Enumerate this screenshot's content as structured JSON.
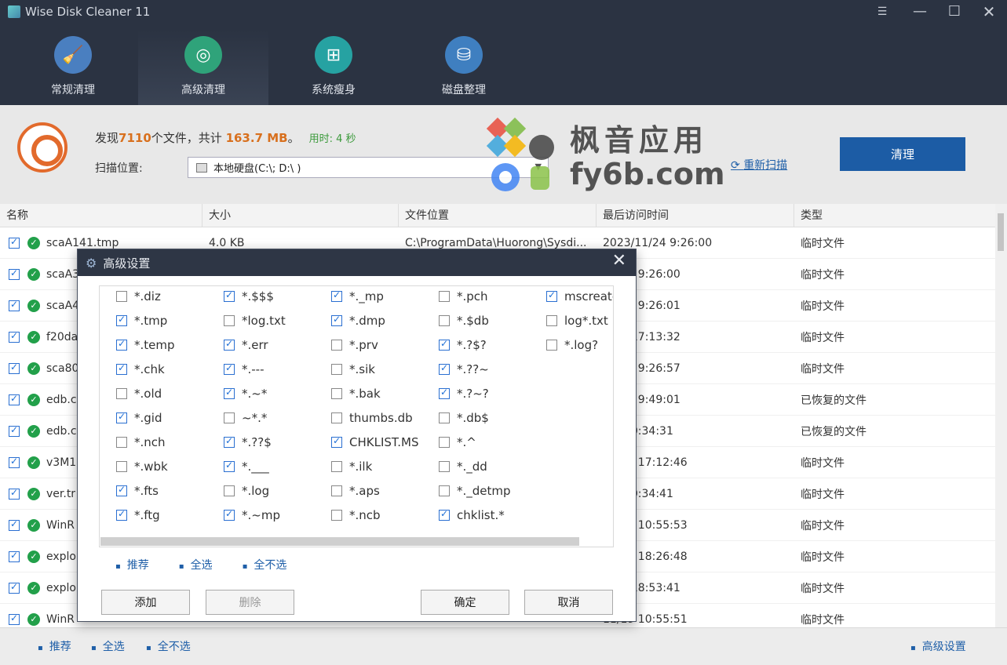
{
  "window": {
    "title": "Wise Disk Cleaner 11"
  },
  "tabs": [
    {
      "label": "常规清理",
      "color": "#4a7fc0",
      "icon": "broom-icon"
    },
    {
      "label": "高级清理",
      "color": "#2fa37a",
      "icon": "advanced-clean-icon"
    },
    {
      "label": "系统瘦身",
      "color": "#26a2a2",
      "icon": "windows-icon"
    },
    {
      "label": "磁盘整理",
      "color": "#3f7fc0",
      "icon": "disk-defrag-icon"
    }
  ],
  "summary": {
    "prefix": "发现",
    "count": "7110",
    "mid": "个文件，共计",
    "size": "163.7 MB",
    "suffix": "。",
    "time": "用时: 4 秒",
    "scan_label": "扫描位置:",
    "scan_value": "本地硬盘(C:\\; D:\\ )",
    "rescan": "重新扫描",
    "clean": "清理"
  },
  "watermark": {
    "line1": "枫音应用",
    "line2": "fy6b.com"
  },
  "table": {
    "columns": [
      "名称",
      "大小",
      "文件位置",
      "最后访问时间",
      "类型"
    ],
    "rows": [
      {
        "name": "scaA141.tmp",
        "size": "4.0 KB",
        "path": "C:\\ProgramData\\Huorong\\Sysdi...",
        "time": "2023/11/24 9:26:00",
        "type": "临时文件"
      },
      {
        "name": "scaA3",
        "size": "",
        "path": "",
        "time": "11/24 9:26:00",
        "type": "临时文件"
      },
      {
        "name": "scaA4",
        "size": "",
        "path": "",
        "time": "11/24 9:26:01",
        "type": "临时文件"
      },
      {
        "name": "f20da",
        "size": "",
        "path": "",
        "time": "3/14 17:13:32",
        "type": "临时文件"
      },
      {
        "name": "sca80",
        "size": "",
        "path": "",
        "time": "11/24 9:26:57",
        "type": "临时文件"
      },
      {
        "name": "edb.c",
        "size": "",
        "path": "",
        "time": "11/24 9:49:01",
        "type": "已恢复的文件"
      },
      {
        "name": "edb.c",
        "size": "",
        "path": "",
        "time": "3/3 20:34:31",
        "type": "已恢复的文件"
      },
      {
        "name": "v3M1",
        "size": "",
        "path": "",
        "time": "10/27 17:12:46",
        "type": "临时文件"
      },
      {
        "name": "ver.tr",
        "size": "",
        "path": "",
        "time": "4/22 0:34:41",
        "type": "临时文件"
      },
      {
        "name": "WinR",
        "size": "",
        "path": "",
        "time": "11/19 10:55:53",
        "type": "临时文件"
      },
      {
        "name": "explo",
        "size": "",
        "path": "",
        "time": "11/11 18:26:48",
        "type": "临时文件"
      },
      {
        "name": "explo",
        "size": "",
        "path": "",
        "time": "11/9 18:53:41",
        "type": "临时文件"
      },
      {
        "name": "WinR",
        "size": "",
        "path": "",
        "time": "11/19 10:55:51",
        "type": "临时文件"
      }
    ]
  },
  "footer": {
    "recommend": "推荐",
    "select_all": "全选",
    "select_none": "全不选",
    "advanced": "高级设置"
  },
  "dialog": {
    "title": "高级设置",
    "columns": [
      [
        {
          "t": "*.diz",
          "c": false
        },
        {
          "t": "*.tmp",
          "c": true
        },
        {
          "t": "*.temp",
          "c": true
        },
        {
          "t": "*.chk",
          "c": true
        },
        {
          "t": "*.old",
          "c": false
        },
        {
          "t": "*.gid",
          "c": true
        },
        {
          "t": "*.nch",
          "c": false
        },
        {
          "t": "*.wbk",
          "c": false
        },
        {
          "t": "*.fts",
          "c": true
        },
        {
          "t": "*.ftg",
          "c": true
        }
      ],
      [
        {
          "t": "*.$$$",
          "c": true
        },
        {
          "t": "*log.txt",
          "c": false
        },
        {
          "t": "*.err",
          "c": true
        },
        {
          "t": "*.---",
          "c": true
        },
        {
          "t": "*.~*",
          "c": true
        },
        {
          "t": "~*.*",
          "c": false
        },
        {
          "t": "*.??$",
          "c": true
        },
        {
          "t": "*.___",
          "c": true
        },
        {
          "t": "*.log",
          "c": false
        },
        {
          "t": "*.~mp",
          "c": true
        }
      ],
      [
        {
          "t": "*._mp",
          "c": true
        },
        {
          "t": "*.dmp",
          "c": true
        },
        {
          "t": "*.prv",
          "c": false
        },
        {
          "t": "*.sik",
          "c": false
        },
        {
          "t": "*.bak",
          "c": false
        },
        {
          "t": "thumbs.db",
          "c": false
        },
        {
          "t": "CHKLIST.MS",
          "c": true
        },
        {
          "t": "*.ilk",
          "c": false
        },
        {
          "t": "*.aps",
          "c": false
        },
        {
          "t": "*.ncb",
          "c": false
        }
      ],
      [
        {
          "t": "*.pch",
          "c": false
        },
        {
          "t": "*.$db",
          "c": false
        },
        {
          "t": "*.?$?",
          "c": true
        },
        {
          "t": "*.??~",
          "c": true
        },
        {
          "t": "*.?~?",
          "c": true
        },
        {
          "t": "*.db$",
          "c": false
        },
        {
          "t": "*.^",
          "c": false
        },
        {
          "t": "*._dd",
          "c": false
        },
        {
          "t": "*._detmp",
          "c": false
        },
        {
          "t": "chklist.*",
          "c": true
        }
      ],
      [
        {
          "t": "mscreate",
          "c": true
        },
        {
          "t": "log*.txt",
          "c": false
        },
        {
          "t": "*.log?",
          "c": false
        }
      ]
    ],
    "links": {
      "recommend": "推荐",
      "select_all": "全选",
      "select_none": "全不选"
    },
    "buttons": {
      "add": "添加",
      "delete": "删除",
      "ok": "确定",
      "cancel": "取消"
    }
  }
}
